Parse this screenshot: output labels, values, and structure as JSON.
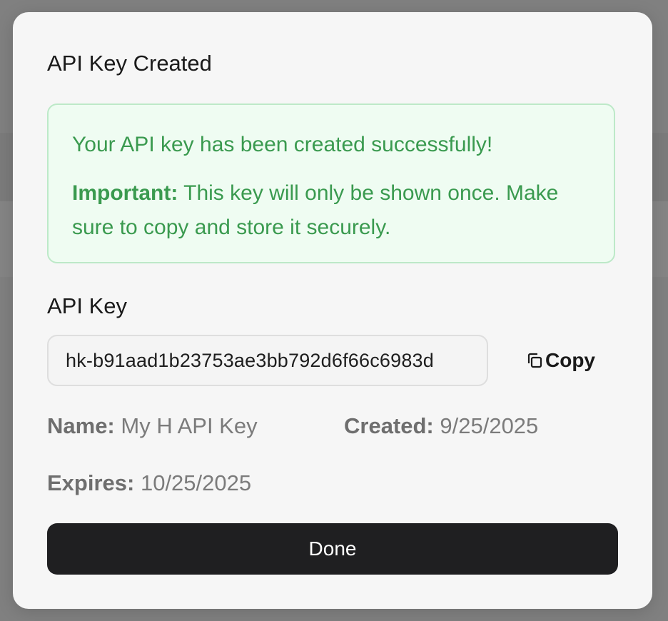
{
  "dialog": {
    "title": "API Key Created",
    "alert": {
      "message": "Your API key has been created successfully!",
      "important_label": "Important:",
      "important_text": " This key will only be shown once. Make sure to copy and store it securely."
    },
    "key_label": "API Key",
    "key_value": "hk-b91aad1b23753ae3bb792d6f66c6983d",
    "copy_label": "Copy",
    "meta": {
      "name_label": "Name:",
      "name_value": " My H API Key",
      "created_label": "Created:",
      "created_value": " 9/25/2025",
      "expires_label": "Expires:",
      "expires_value": " 10/25/2025"
    },
    "done_label": "Done"
  },
  "colors": {
    "success_text": "#3a9a4f",
    "success_bg": "#effcf2",
    "success_border": "#bde9c8",
    "primary_button": "#1f1f21"
  },
  "icons": {
    "copy": "copy-icon"
  }
}
